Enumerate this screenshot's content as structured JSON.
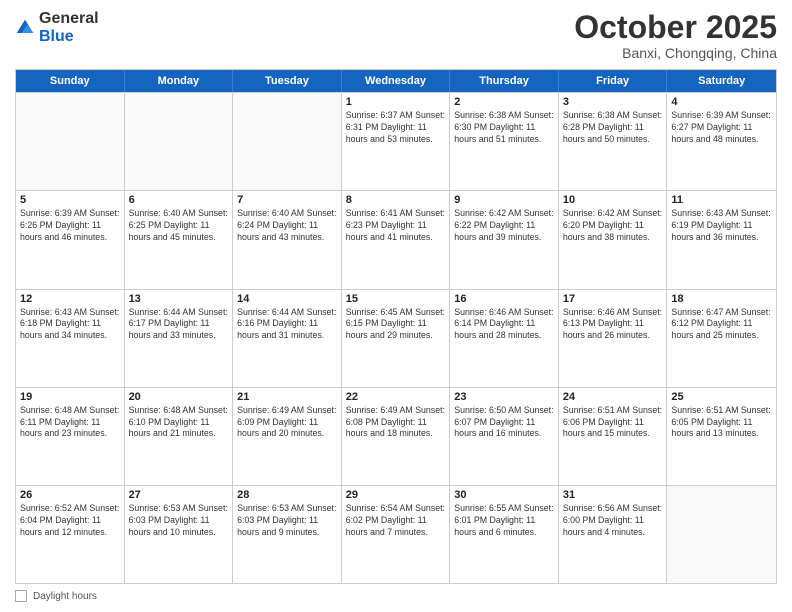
{
  "header": {
    "logo_general": "General",
    "logo_blue": "Blue",
    "month": "October 2025",
    "location": "Banxi, Chongqing, China"
  },
  "days_of_week": [
    "Sunday",
    "Monday",
    "Tuesday",
    "Wednesday",
    "Thursday",
    "Friday",
    "Saturday"
  ],
  "footer": {
    "label": "Daylight hours"
  },
  "weeks": [
    [
      {
        "day": "",
        "info": ""
      },
      {
        "day": "",
        "info": ""
      },
      {
        "day": "",
        "info": ""
      },
      {
        "day": "1",
        "info": "Sunrise: 6:37 AM\nSunset: 6:31 PM\nDaylight: 11 hours and 53 minutes."
      },
      {
        "day": "2",
        "info": "Sunrise: 6:38 AM\nSunset: 6:30 PM\nDaylight: 11 hours and 51 minutes."
      },
      {
        "day": "3",
        "info": "Sunrise: 6:38 AM\nSunset: 6:28 PM\nDaylight: 11 hours and 50 minutes."
      },
      {
        "day": "4",
        "info": "Sunrise: 6:39 AM\nSunset: 6:27 PM\nDaylight: 11 hours and 48 minutes."
      }
    ],
    [
      {
        "day": "5",
        "info": "Sunrise: 6:39 AM\nSunset: 6:26 PM\nDaylight: 11 hours and 46 minutes."
      },
      {
        "day": "6",
        "info": "Sunrise: 6:40 AM\nSunset: 6:25 PM\nDaylight: 11 hours and 45 minutes."
      },
      {
        "day": "7",
        "info": "Sunrise: 6:40 AM\nSunset: 6:24 PM\nDaylight: 11 hours and 43 minutes."
      },
      {
        "day": "8",
        "info": "Sunrise: 6:41 AM\nSunset: 6:23 PM\nDaylight: 11 hours and 41 minutes."
      },
      {
        "day": "9",
        "info": "Sunrise: 6:42 AM\nSunset: 6:22 PM\nDaylight: 11 hours and 39 minutes."
      },
      {
        "day": "10",
        "info": "Sunrise: 6:42 AM\nSunset: 6:20 PM\nDaylight: 11 hours and 38 minutes."
      },
      {
        "day": "11",
        "info": "Sunrise: 6:43 AM\nSunset: 6:19 PM\nDaylight: 11 hours and 36 minutes."
      }
    ],
    [
      {
        "day": "12",
        "info": "Sunrise: 6:43 AM\nSunset: 6:18 PM\nDaylight: 11 hours and 34 minutes."
      },
      {
        "day": "13",
        "info": "Sunrise: 6:44 AM\nSunset: 6:17 PM\nDaylight: 11 hours and 33 minutes."
      },
      {
        "day": "14",
        "info": "Sunrise: 6:44 AM\nSunset: 6:16 PM\nDaylight: 11 hours and 31 minutes."
      },
      {
        "day": "15",
        "info": "Sunrise: 6:45 AM\nSunset: 6:15 PM\nDaylight: 11 hours and 29 minutes."
      },
      {
        "day": "16",
        "info": "Sunrise: 6:46 AM\nSunset: 6:14 PM\nDaylight: 11 hours and 28 minutes."
      },
      {
        "day": "17",
        "info": "Sunrise: 6:46 AM\nSunset: 6:13 PM\nDaylight: 11 hours and 26 minutes."
      },
      {
        "day": "18",
        "info": "Sunrise: 6:47 AM\nSunset: 6:12 PM\nDaylight: 11 hours and 25 minutes."
      }
    ],
    [
      {
        "day": "19",
        "info": "Sunrise: 6:48 AM\nSunset: 6:11 PM\nDaylight: 11 hours and 23 minutes."
      },
      {
        "day": "20",
        "info": "Sunrise: 6:48 AM\nSunset: 6:10 PM\nDaylight: 11 hours and 21 minutes."
      },
      {
        "day": "21",
        "info": "Sunrise: 6:49 AM\nSunset: 6:09 PM\nDaylight: 11 hours and 20 minutes."
      },
      {
        "day": "22",
        "info": "Sunrise: 6:49 AM\nSunset: 6:08 PM\nDaylight: 11 hours and 18 minutes."
      },
      {
        "day": "23",
        "info": "Sunrise: 6:50 AM\nSunset: 6:07 PM\nDaylight: 11 hours and 16 minutes."
      },
      {
        "day": "24",
        "info": "Sunrise: 6:51 AM\nSunset: 6:06 PM\nDaylight: 11 hours and 15 minutes."
      },
      {
        "day": "25",
        "info": "Sunrise: 6:51 AM\nSunset: 6:05 PM\nDaylight: 11 hours and 13 minutes."
      }
    ],
    [
      {
        "day": "26",
        "info": "Sunrise: 6:52 AM\nSunset: 6:04 PM\nDaylight: 11 hours and 12 minutes."
      },
      {
        "day": "27",
        "info": "Sunrise: 6:53 AM\nSunset: 6:03 PM\nDaylight: 11 hours and 10 minutes."
      },
      {
        "day": "28",
        "info": "Sunrise: 6:53 AM\nSunset: 6:03 PM\nDaylight: 11 hours and 9 minutes."
      },
      {
        "day": "29",
        "info": "Sunrise: 6:54 AM\nSunset: 6:02 PM\nDaylight: 11 hours and 7 minutes."
      },
      {
        "day": "30",
        "info": "Sunrise: 6:55 AM\nSunset: 6:01 PM\nDaylight: 11 hours and 6 minutes."
      },
      {
        "day": "31",
        "info": "Sunrise: 6:56 AM\nSunset: 6:00 PM\nDaylight: 11 hours and 4 minutes."
      },
      {
        "day": "",
        "info": ""
      }
    ]
  ]
}
